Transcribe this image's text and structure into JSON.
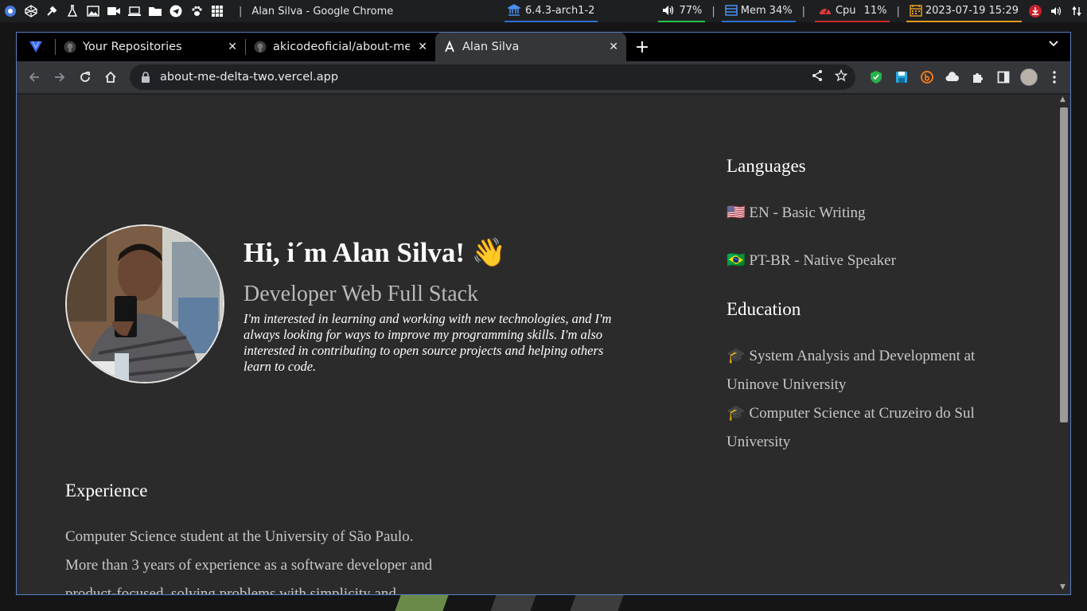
{
  "system_bar": {
    "window_title": "Alan Silva - Google Chrome",
    "kernel": "6.4.3-arch1-2",
    "volume": "77%",
    "memory_label": "Mem",
    "memory_value": "34%",
    "cpu_label": "Cpu",
    "cpu_value": "11%",
    "datetime": "2023-07-19 15:29",
    "separator": "|"
  },
  "browser": {
    "tabs": [
      {
        "label": "Your Repositories",
        "close": "✕"
      },
      {
        "label": "akicodeoficial/about-me:",
        "close": "✕"
      },
      {
        "label": "Alan Silva",
        "close": "✕"
      }
    ],
    "new_tab": "+",
    "url": "about-me-delta-two.vercel.app"
  },
  "page": {
    "greeting": "Hi, i´m Alan Silva! 👋",
    "role": "Developer Web Full Stack",
    "about": "I'm interested in learning and working with new technologies, and I'm always looking for ways to improve my programming skills. I'm also interested in contributing to open source projects and helping others learn to code.",
    "languages_title": "Languages",
    "languages": [
      "🇺🇸 EN - Basic Writing",
      "🇧🇷 PT-BR - Native Speaker"
    ],
    "education_title": "Education",
    "education": [
      "🎓 System Analysis and Development at Uninove University",
      "🎓 Computer Science at Cruzeiro do Sul University"
    ],
    "experience_title": "Experience",
    "experience": [
      "Computer Science student at the University of São Paulo.",
      "More than 3 years of experience as a software developer and",
      "product-focused, solving problems with simplicity and"
    ]
  }
}
